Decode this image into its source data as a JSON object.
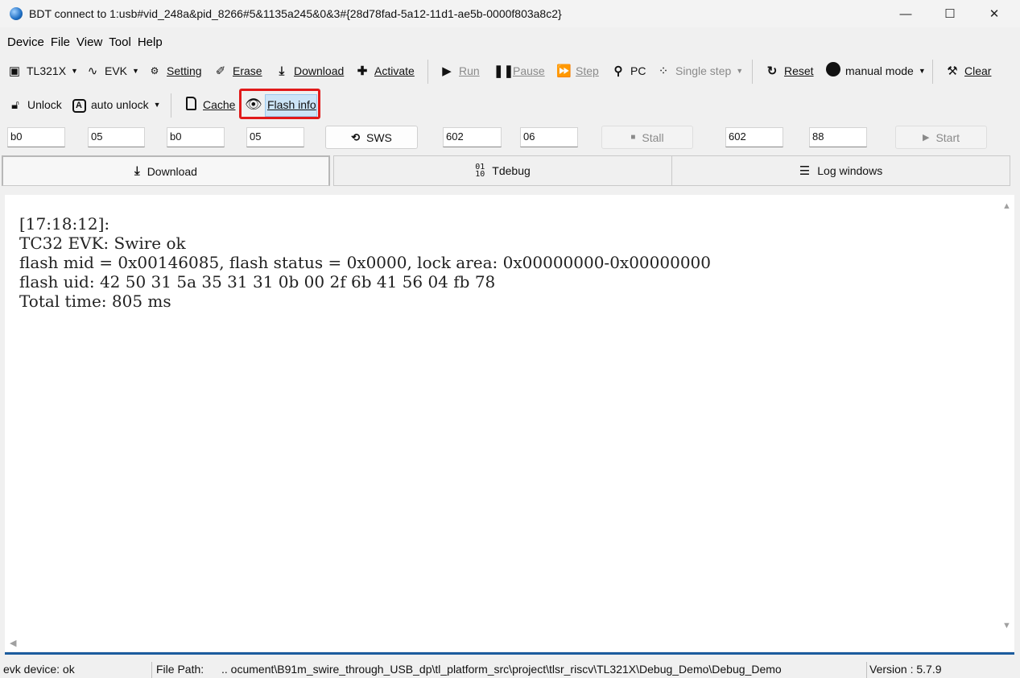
{
  "window": {
    "title": "BDT connect to 1:usb#vid_248a&pid_8266#5&1135a245&0&3#{28d78fad-5a12-11d1-ae5b-0000f803a8c2}",
    "minimize_glyph": "—",
    "maximize_glyph": "☐",
    "close_glyph": "✕"
  },
  "menu": [
    "Device",
    "File",
    "View",
    "Tool",
    "Help"
  ],
  "toolbar1": {
    "chip": {
      "label": "TL321X",
      "icon": "chip-icon"
    },
    "evk": {
      "label": "EVK",
      "icon": "wave-icon"
    },
    "setting": {
      "label": "Setting",
      "icon": "gear-icon"
    },
    "erase": {
      "label": "Erase",
      "icon": "eraser-icon"
    },
    "download": {
      "label": "Download",
      "icon": "download-icon"
    },
    "activate": {
      "label": "Activate",
      "icon": "plus-icon"
    },
    "run": {
      "label": "Run",
      "icon": "run-icon"
    },
    "pause": {
      "label": "Pause",
      "icon": "pause-icon"
    },
    "step": {
      "label": "Step",
      "icon": "step-icon"
    },
    "pc": {
      "label": "PC",
      "icon": "search-icon"
    },
    "single_step": {
      "label": "Single step",
      "icon": "footsteps-icon"
    },
    "reset": {
      "label": "Reset",
      "icon": "reset-icon"
    },
    "manual_mode": {
      "label": "manual mode",
      "icon": "mode-icon"
    },
    "clear": {
      "label": "Clear",
      "icon": "broom-icon"
    }
  },
  "toolbar2": {
    "unlock": {
      "label": "Unlock",
      "icon": "unlock-icon"
    },
    "auto_unlock": {
      "label": "auto unlock",
      "icon": "auto-unlock-icon"
    },
    "cache": {
      "label": "Cache",
      "icon": "sd-card-icon"
    },
    "flash_info": {
      "label": "Flash info",
      "icon": "eye-icon"
    }
  },
  "inputs": {
    "f1": "b0",
    "f2": "05",
    "f3": "b0",
    "f4": "05",
    "sws_label": "SWS",
    "f5": "602",
    "f6": "06",
    "stall_label": "Stall",
    "f7": "602",
    "f8": "88",
    "start_label": "Start"
  },
  "tabs": [
    {
      "label": "Download",
      "icon": "download-icon",
      "active": true
    },
    {
      "label": "Tdebug",
      "icon": "binary-search-icon",
      "active": false
    },
    {
      "label": "Log windows",
      "icon": "list-icon",
      "active": false
    }
  ],
  "log_text": "[17:18:12]:\nTC32 EVK: Swire ok\nflash mid = 0x00146085, flash status = 0x0000, lock area: 0x00000000-0x00000000\nflash uid: 42 50 31 5a 35 31 31 0b 00 2f 6b 41 56 04 fb 78\nTotal time: 805 ms",
  "status": {
    "device": "evk device: ok",
    "file_path_label": "File Path:",
    "file_path_value": "..  ocument\\B91m_swire_through_USB_dp\\tl_platform_src\\project\\tlsr_riscv\\TL321X\\Debug_Demo\\Debug_Demo",
    "version": "Version : 5.7.9"
  },
  "colors": {
    "highlight_border": "#e11a1a",
    "selection": "#cce4f7",
    "accent_line": "#1c5c9e"
  }
}
